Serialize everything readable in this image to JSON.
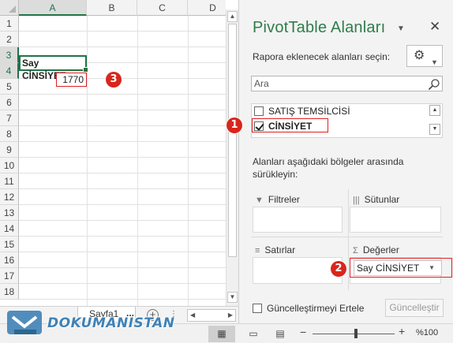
{
  "grid": {
    "columns": [
      "A",
      "B",
      "C",
      "D"
    ],
    "rows": [
      "1",
      "2",
      "3",
      "4",
      "5",
      "6",
      "7",
      "8",
      "9",
      "10",
      "11",
      "12",
      "13",
      "14",
      "15",
      "16",
      "17",
      "18"
    ],
    "cell_a3": "Say CİNSİYET",
    "cell_a4": "1770"
  },
  "badges": {
    "b1": "1",
    "b2": "2",
    "b3": "3"
  },
  "sheet_tabs": {
    "active": "Sayfa1",
    "more": "..."
  },
  "panel": {
    "title": "PivotTable Alanları",
    "subtitle": "Rapora eklenecek alanları seçin:",
    "search_placeholder": "Ara",
    "fields": [
      {
        "label": "SATIŞ TEMSİLCİSİ",
        "checked": false
      },
      {
        "label": "CİNSİYET",
        "checked": true
      }
    ],
    "info": "Alanları aşağıdaki bölgeler arasında sürükleyin:",
    "areas": {
      "filters": "Filtreler",
      "columns": "Sütunlar",
      "rows": "Satırlar",
      "values": "Değerler"
    },
    "values_item": "Say CİNSİYET",
    "defer_label": "Güncelleştirmeyi Ertele",
    "update_label": "Güncelleştir"
  },
  "status": {
    "zoom": "%100"
  },
  "watermark": "DOKUMANISTAN",
  "colors": {
    "accent": "#217346",
    "highlight": "#e02020",
    "badge": "#d9261c",
    "title": "#2e7d4a"
  }
}
